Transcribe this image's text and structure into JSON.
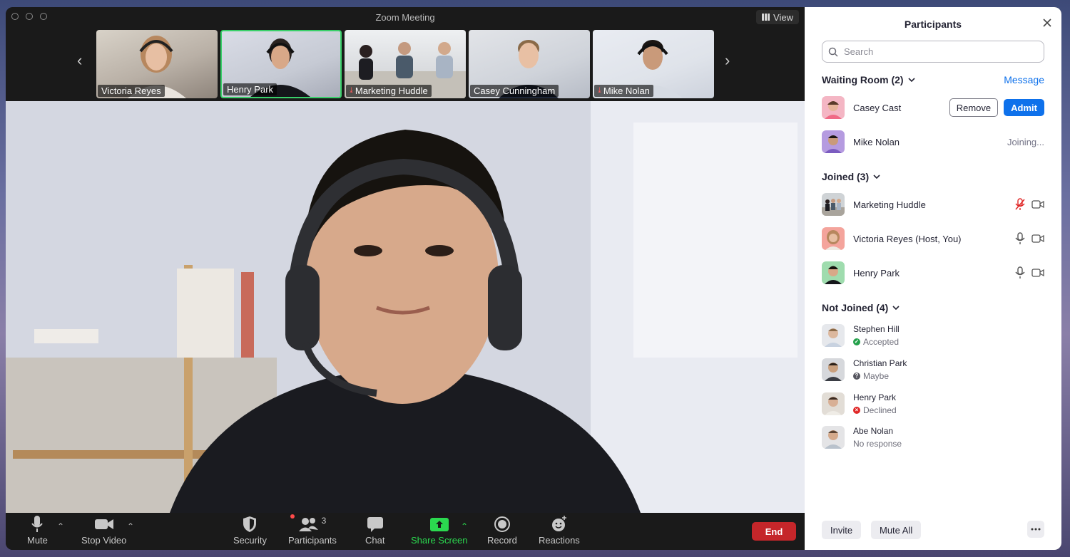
{
  "window": {
    "title": "Zoom Meeting",
    "view_label": "View"
  },
  "thumbnails": [
    {
      "name": "Victoria Reyes",
      "muted": false,
      "active": false
    },
    {
      "name": "Henry Park",
      "muted": false,
      "active": true
    },
    {
      "name": "Marketing Huddle",
      "muted": true,
      "active": false
    },
    {
      "name": "Casey Cunningham",
      "muted": false,
      "active": false
    },
    {
      "name": "Mike Nolan",
      "muted": true,
      "active": false
    }
  ],
  "toolbar": {
    "mute": "Mute",
    "stop_video": "Stop Video",
    "security": "Security",
    "participants": "Participants",
    "participants_count": "3",
    "chat": "Chat",
    "share_screen": "Share Screen",
    "record": "Record",
    "reactions": "Reactions",
    "end": "End"
  },
  "panel": {
    "title": "Participants",
    "search_placeholder": "Search",
    "waiting_room": {
      "heading": "Waiting Room (2)",
      "message_label": "Message",
      "people": [
        {
          "name": "Casey Cast",
          "remove": "Remove",
          "admit": "Admit"
        },
        {
          "name": "Mike Nolan",
          "status": "Joining..."
        }
      ]
    },
    "joined": {
      "heading": "Joined (3)",
      "people": [
        {
          "name": "Marketing Huddle",
          "mic_muted": true
        },
        {
          "name": "Victoria Reyes (Host, You)",
          "mic_muted": false
        },
        {
          "name": "Henry Park",
          "mic_muted": false
        }
      ]
    },
    "not_joined": {
      "heading": "Not Joined (4)",
      "people": [
        {
          "name": "Stephen Hill",
          "status": "Accepted"
        },
        {
          "name": "Christian Park",
          "status": "Maybe"
        },
        {
          "name": "Henry Park",
          "status": "Declined"
        },
        {
          "name": "Abe Nolan",
          "status": "No response"
        }
      ]
    },
    "invite": "Invite",
    "mute_all": "Mute All"
  },
  "colors": {
    "accent": "#0e71eb",
    "end": "#c5262a",
    "share": "#2bd94f",
    "active_border": "#3ad06a",
    "muted": "#e02828"
  }
}
